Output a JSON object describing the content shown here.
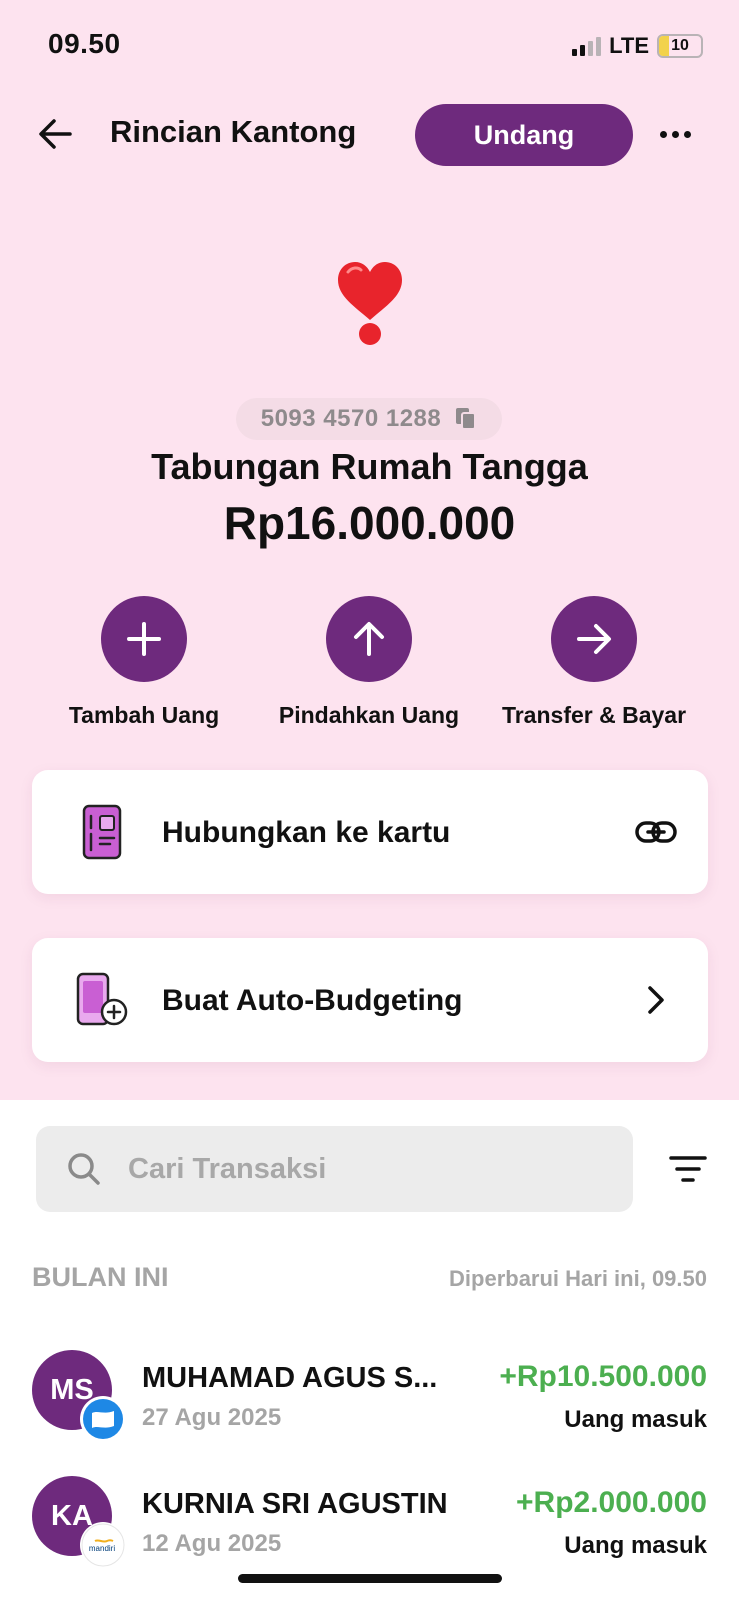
{
  "status_bar": {
    "time": "09.50",
    "network": "LTE",
    "battery": "10"
  },
  "header": {
    "title": "Rincian Kantong",
    "invite_label": "Undang"
  },
  "pocket": {
    "emoji": "❣️",
    "account_number": "5093 4570 1288",
    "name": "Tabungan Rumah Tangga",
    "balance": "Rp16.000.000"
  },
  "actions": [
    {
      "label": "Tambah Uang",
      "icon": "plus-icon"
    },
    {
      "label": "Pindahkan Uang",
      "icon": "arrow-up-icon"
    },
    {
      "label": "Transfer & Bayar",
      "icon": "arrow-right-icon"
    }
  ],
  "cards": {
    "link_card": {
      "label": "Hubungkan ke kartu",
      "icon": "card-icon",
      "trail_icon": "link-icon"
    },
    "auto_budget": {
      "label": "Buat Auto-Budgeting",
      "icon": "phone-budget-icon",
      "trail_icon": "chevron-right-icon"
    }
  },
  "search": {
    "placeholder": "Cari Transaksi"
  },
  "transactions_section": {
    "title": "BULAN INI",
    "updated": "Diperbarui Hari ini, 09.50"
  },
  "transactions": [
    {
      "initials": "MS",
      "name": "MUHAMAD AGUS S...",
      "date": "27 Agu 2025",
      "amount": "+Rp10.500.000",
      "type": "Uang masuk",
      "bank_badge": "blue-bank-icon"
    },
    {
      "initials": "KA",
      "name": "KURNIA SRI AGUSTIN",
      "date": "12 Agu 2025",
      "amount": "+Rp2.000.000",
      "type": "Uang masuk",
      "bank_badge": "mandiri"
    }
  ],
  "colors": {
    "accent": "#6e2a7d",
    "background_top": "#fde3ef",
    "positive": "#4caf50",
    "muted": "#a5a5a5"
  }
}
